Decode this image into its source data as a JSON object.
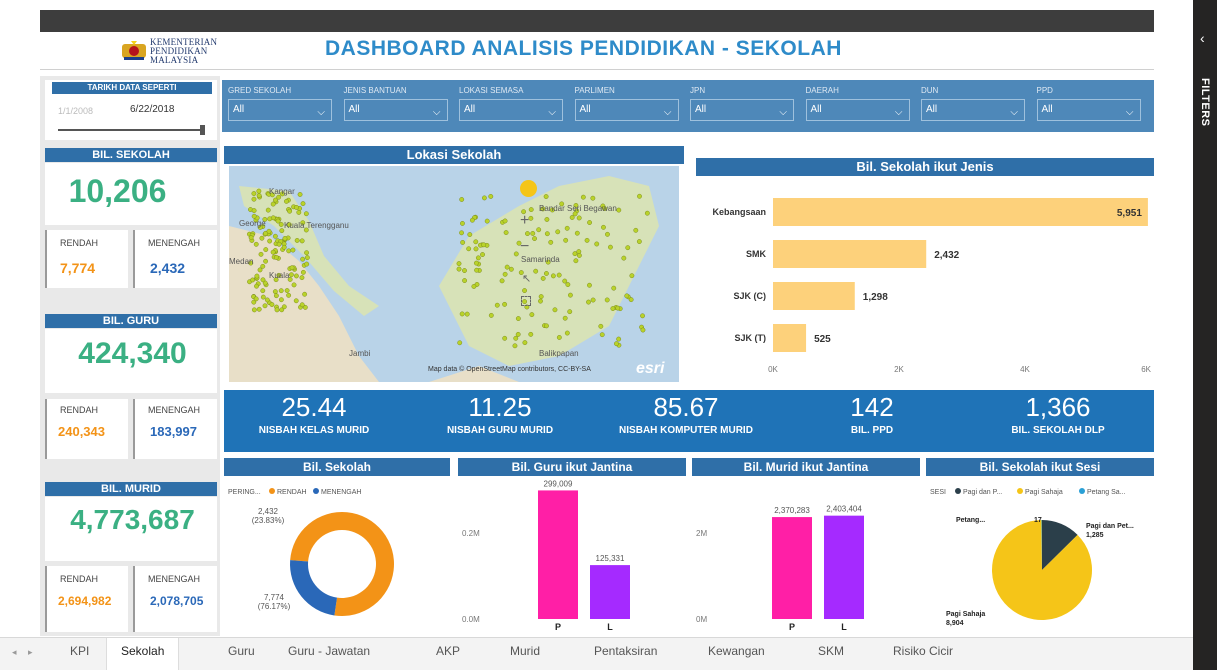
{
  "header": {
    "logo_line1": "KEMENTERIAN",
    "logo_line2": "PENDIDIKAN",
    "logo_line3": "MALAYSIA",
    "title": "DASHBOARD ANALISIS PENDIDIKAN - SEKOLAH"
  },
  "date_slicer": {
    "label": "TARIKH DATA SEPERTI",
    "start": "1/1/2008",
    "end": "6/22/2018",
    "position": 1.0
  },
  "kpis": {
    "sekolah": {
      "label": "BIL. SEKOLAH",
      "value": "10,206",
      "rendah_label": "RENDAH",
      "rendah": "7,774",
      "menengah_label": "MENENGAH",
      "menengah": "2,432"
    },
    "guru": {
      "label": "BIL. GURU",
      "value": "424,340",
      "rendah_label": "RENDAH",
      "rendah": "240,343",
      "menengah_label": "MENENGAH",
      "menengah": "183,997"
    },
    "murid": {
      "label": "BIL. MURID",
      "value": "4,773,687",
      "rendah_label": "RENDAH",
      "rendah": "2,694,982",
      "menengah_label": "MENENGAH",
      "menengah": "2,078,705"
    }
  },
  "filters": [
    {
      "label": "GRED SEKOLAH",
      "value": "All"
    },
    {
      "label": "JENIS BANTUAN",
      "value": "All"
    },
    {
      "label": "LOKASI SEMASA",
      "value": "All"
    },
    {
      "label": "PARLIMEN",
      "value": "All"
    },
    {
      "label": "JPN",
      "value": "All"
    },
    {
      "label": "DAERAH",
      "value": "All"
    },
    {
      "label": "DUN",
      "value": "All"
    },
    {
      "label": "PPD",
      "value": "All"
    }
  ],
  "map": {
    "title": "Lokasi Sekolah",
    "places": [
      "Kangar",
      "George",
      "Kuala Terengganu",
      "Medan",
      "Kuala",
      "Bandar Seri Begawan",
      "Samarinda",
      "Balikpapan",
      "Jambi"
    ],
    "attribution": "Map data © OpenStreetMap contributors, CC-BY-SA",
    "esri": "esri"
  },
  "stats": [
    {
      "value": "25.44",
      "label": "NISBAH KELAS MURID"
    },
    {
      "value": "11.25",
      "label": "NISBAH GURU MURID"
    },
    {
      "value": "85.67",
      "label": "NISBAH KOMPUTER MURID"
    },
    {
      "value": "142",
      "label": "BIL. PPD"
    },
    {
      "value": "1,366",
      "label": "BIL. SEKOLAH DLP"
    }
  ],
  "tabs": [
    "KPI",
    "Sekolah",
    "Guru",
    "Guru - Jawatan",
    "AKP",
    "Murid",
    "Pentaksiran",
    "Kewangan",
    "SKM",
    "Risiko Cicir"
  ],
  "active_tab": "Sekolah",
  "side": {
    "filters_label": "FILTERS",
    "collapse_icon": "chevron-left-icon"
  },
  "colors": {
    "accent": "#2f6fa8",
    "bar_yellow": "#fdd17b",
    "green": "#3bb083",
    "orange": "#f39317",
    "blue": "#2a68b8",
    "pink": "#ff1fa6",
    "purple": "#a52aff",
    "pie_yellow": "#f5c518",
    "pie_dark": "#2b3f4a"
  },
  "chart_data": [
    {
      "type": "bar",
      "orientation": "horizontal",
      "title": "Bil. Sekolah ikut Jenis",
      "categories": [
        "Kebangsaan",
        "SMK",
        "SJK (C)",
        "SJK (T)"
      ],
      "values": [
        5951,
        2432,
        1298,
        525
      ],
      "value_labels": [
        "5,951",
        "2,432",
        "1,298",
        "525"
      ],
      "xlim": [
        0,
        6000
      ],
      "xticks": [
        "0K",
        "2K",
        "4K",
        "6K"
      ],
      "grid": false
    },
    {
      "type": "pie",
      "donut": true,
      "title": "Bil. Sekolah",
      "legend_title": "PERING...",
      "legend": [
        "RENDAH",
        "MENENGAH"
      ],
      "values": [
        7774,
        2432
      ],
      "labels": [
        "7,774",
        "2,432"
      ],
      "percents": [
        "(76.17%)",
        "(23.83%)"
      ]
    },
    {
      "type": "bar",
      "title": "Bil. Guru ikut Jantina",
      "categories": [
        "P",
        "L"
      ],
      "values": [
        299009,
        125331
      ],
      "value_labels": [
        "299,009",
        "125,331"
      ],
      "ylim": [
        0,
        0.3
      ],
      "yticks": [
        "0.0M",
        "0.2M"
      ]
    },
    {
      "type": "bar",
      "title": "Bil. Murid ikut Jantina",
      "categories": [
        "P",
        "L"
      ],
      "values": [
        2370283,
        2403404
      ],
      "value_labels": [
        "2,370,283",
        "2,403,404"
      ],
      "ylim": [
        0,
        3
      ],
      "yticks": [
        "0M",
        "2M"
      ]
    },
    {
      "type": "pie",
      "title": "Bil. Sekolah ikut Sesi",
      "legend_title": "SESI",
      "legend": [
        "Pagi dan P...",
        "Pagi Sahaja",
        "Petang Sa..."
      ],
      "values": [
        1285,
        8904,
        17
      ],
      "labels": [
        "Pagi dan Pet... 1,285",
        "Pagi Sahaja 8,904",
        "Petang... 17"
      ]
    }
  ]
}
